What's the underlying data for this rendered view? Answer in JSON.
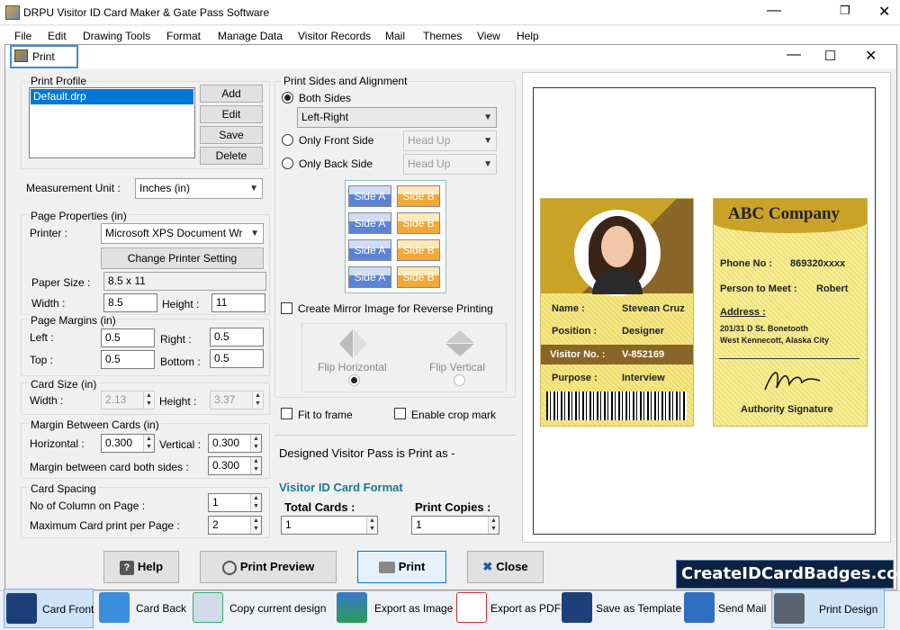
{
  "app": {
    "title": "DRPU Visitor ID Card Maker & Gate Pass Software",
    "menu": [
      "File",
      "Edit",
      "Drawing Tools",
      "Format",
      "Manage Data",
      "Visitor Records",
      "Mail",
      "Themes",
      "View",
      "Help"
    ]
  },
  "dialog": {
    "title": "Print"
  },
  "print_profile": {
    "label": "Print Profile",
    "items": [
      "Default.drp"
    ],
    "buttons": {
      "add": "Add",
      "edit": "Edit",
      "save": "Save",
      "delete": "Delete"
    }
  },
  "measurement": {
    "label": "Measurement Unit :",
    "value": "Inches (in)"
  },
  "page_properties": {
    "label": "Page Properties (in)",
    "printer_label": "Printer :",
    "printer_value": "Microsoft XPS Document Wr",
    "change_printer": "Change Printer Setting",
    "paper_size_label": "Paper Size :",
    "paper_size_value": "8.5 x 11",
    "width_label": "Width :",
    "width_value": "8.5",
    "height_label": "Height :",
    "height_value": "11"
  },
  "page_margins": {
    "label": "Page Margins (in)",
    "left_label": "Left :",
    "left": "0.5",
    "right_label": "Right :",
    "right": "0.5",
    "top_label": "Top :",
    "top": "0.5",
    "bottom_label": "Bottom :",
    "bottom": "0.5"
  },
  "card_size": {
    "label": "Card Size (in)",
    "width_label": "Width :",
    "width": "2.13",
    "height_label": "Height :",
    "height": "3.37"
  },
  "margin_between": {
    "label": "Margin Between Cards (in)",
    "horizontal_label": "Horizontal :",
    "horizontal": "0.300",
    "vertical_label": "Vertical :",
    "vertical": "0.300",
    "both_label": "Margin between card both sides :",
    "both": "0.300"
  },
  "card_spacing": {
    "label": "Card Spacing",
    "columns_label": "No of Column on Page :",
    "columns": "1",
    "max_label": "Maximum Card print per Page :",
    "max": "2"
  },
  "print_sides": {
    "label": "Print Sides and Alignment",
    "both": "Both Sides",
    "both_value": "Left-Right",
    "front": "Only Front Side",
    "front_value": "Head Up",
    "back": "Only Back Side",
    "back_value": "Head Up",
    "side_a": "Side A",
    "side_b": "Side B",
    "mirror": "Create Mirror Image for Reverse Printing",
    "flip_h": "Flip Horizontal",
    "flip_v": "Flip Vertical",
    "fit": "Fit to frame",
    "crop": "Enable crop mark"
  },
  "designed_as": "Designed Visitor Pass is Print as -",
  "format_title": "Visitor ID Card Format",
  "total_cards": {
    "label": "Total Cards :",
    "value": "1"
  },
  "print_copies": {
    "label": "Print Copies :",
    "value": "1"
  },
  "buttons": {
    "help": "Help",
    "preview": "Print Preview",
    "print": "Print",
    "close": "Close"
  },
  "brand": "CreateIDCardBadges.com",
  "front_card": {
    "name_label": "Name :",
    "name": "Stevean Cruz",
    "position_label": "Position :",
    "position": "Designer",
    "visitor_label": "Visitor No. :",
    "visitor": "V-852169",
    "purpose_label": "Purpose :",
    "purpose": "Interview"
  },
  "back_card": {
    "company": "ABC Company",
    "phone_label": "Phone No :",
    "phone": "869320xxxx",
    "meet_label": "Person to Meet :",
    "meet": "Robert",
    "address_label": "Address :",
    "address1": "201/31 D St. Bonetooth",
    "address2": "West Kennecott, Alaska City",
    "signature": "Authority Signature"
  },
  "toolbar": [
    "Card Front",
    "Card Back",
    "Copy current design",
    "Export as Image",
    "Export as PDF",
    "Save as Template",
    "Send Mail",
    "Print Design"
  ],
  "colors": {
    "accent": "#3c8ddc",
    "gold": "#c9a227",
    "brown": "#8a6528",
    "teal": "#1a7a8a"
  }
}
